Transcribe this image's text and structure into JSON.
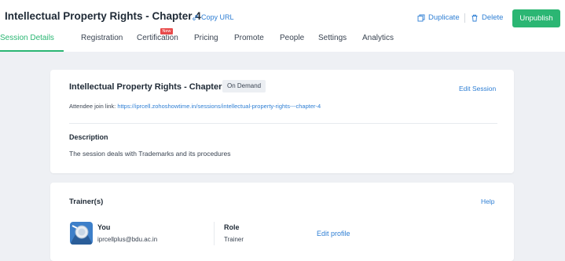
{
  "header": {
    "title": "Intellectual Property Rights - Chapter 4",
    "copy_url": "Copy URL",
    "duplicate": "Duplicate",
    "delete": "Delete",
    "unpublish": "Unpublish"
  },
  "tabs": [
    {
      "label": "Session Details"
    },
    {
      "label": "Registration"
    },
    {
      "label": "Certification",
      "badge": "New"
    },
    {
      "label": "Pricing"
    },
    {
      "label": "Promote"
    },
    {
      "label": "People"
    },
    {
      "label": "Settings"
    },
    {
      "label": "Analytics"
    }
  ],
  "session": {
    "title": "Intellectual Property Rights - Chapter 4",
    "mode": "On Demand",
    "edit": "Edit Session",
    "join_label": "Attendee join link:",
    "join_url": "https://iprcell.zohoshowtime.in/sessions/intellectual-property-rights---chapter-4",
    "description_heading": "Description",
    "description": "The session deals with Trademarks and its procedures"
  },
  "trainers": {
    "heading": "Trainer(s)",
    "help": "Help",
    "list": [
      {
        "name": "You",
        "email": "iprcellplus@bdu.ac.in",
        "role_heading": "Role",
        "role": "Trainer",
        "edit": "Edit profile"
      }
    ]
  },
  "colors": {
    "accent": "#2bb673",
    "link": "#2f7fd4",
    "badge": "#e84a4a",
    "background": "#eef0f4"
  }
}
